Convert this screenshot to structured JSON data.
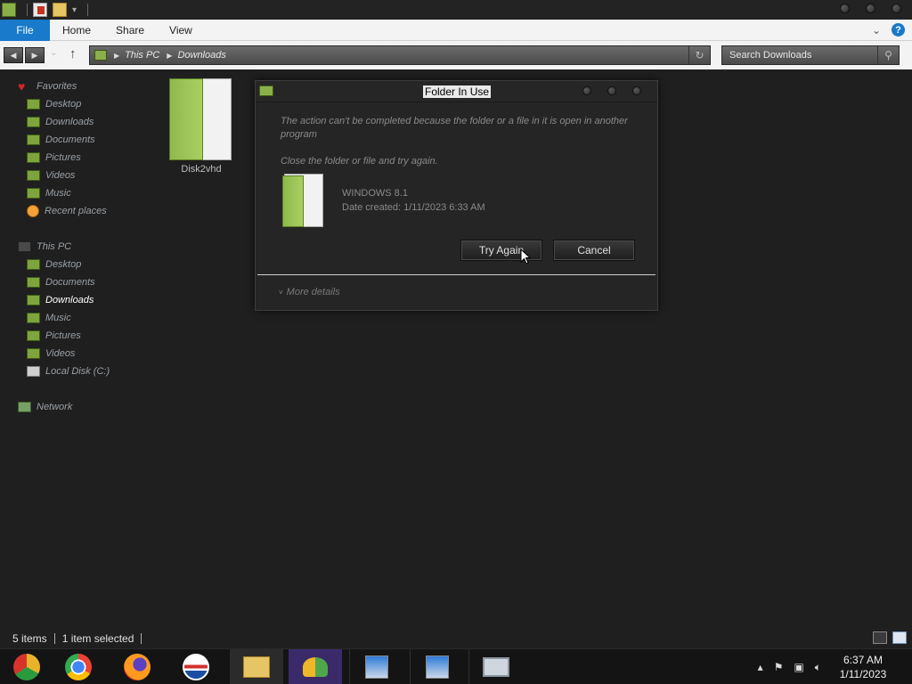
{
  "window": {
    "ribbon_tabs": {
      "file": "File",
      "home": "Home",
      "share": "Share",
      "view": "View"
    }
  },
  "address": {
    "crumbs": [
      "This PC",
      "Downloads"
    ]
  },
  "search": {
    "placeholder": "Search Downloads"
  },
  "sidebar": {
    "favorites": {
      "label": "Favorites",
      "items": [
        "Desktop",
        "Downloads",
        "Documents",
        "Pictures",
        "Videos",
        "Music",
        "Recent places"
      ]
    },
    "this_pc": {
      "label": "This PC",
      "items": [
        "Desktop",
        "Documents",
        "Downloads",
        "Music",
        "Pictures",
        "Videos",
        "Local Disk (C:)"
      ]
    },
    "network": {
      "label": "Network"
    }
  },
  "content": {
    "files": [
      {
        "name": "Disk2vhd",
        "icon": "folder-icon"
      }
    ]
  },
  "dialog": {
    "title": "Folder In Use",
    "message": "The action can't be completed because the folder or a file in it is open in another program",
    "instruction": "Close the folder or file and try again.",
    "item_name": "WINDOWS 8.1",
    "item_date": "Date created: 1/11/2023 6:33 AM",
    "try_again": "Try Again",
    "cancel": "Cancel",
    "more_details": "More details"
  },
  "status": {
    "items": "5 items",
    "selected": "1 item selected"
  },
  "taskbar": {
    "apps": [
      "chrome-canary",
      "chrome",
      "firefox",
      "obama-logo-app",
      "file-explorer",
      "people-app",
      "setup-disc-1",
      "setup-disc-2",
      "monitor-app"
    ],
    "time": "6:37 AM",
    "date": "1/11/2023"
  },
  "colors": {
    "accent": "#1979ca",
    "folder_green": "#8fb94d",
    "background": "#1f1f1f"
  }
}
